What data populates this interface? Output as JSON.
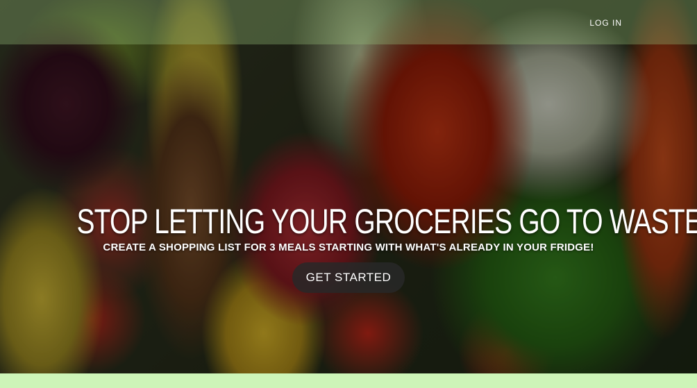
{
  "nav": {
    "login_label": "LOG IN"
  },
  "hero": {
    "headline": "STOP LETTING YOUR GROCERIES GO TO WASTE.",
    "subheadline": "CREATE A SHOPPING LIST FOR 3 MEALS STARTING WITH WHAT'S ALREADY IN YOUR FRIDGE!",
    "cta_label": "GET STARTED",
    "background_image": "assorted-groceries-photo"
  },
  "colors": {
    "topbar": "#96be78",
    "footer_strip": "#cdf5b8",
    "cta_background": "#282828",
    "text": "#ffffff"
  }
}
